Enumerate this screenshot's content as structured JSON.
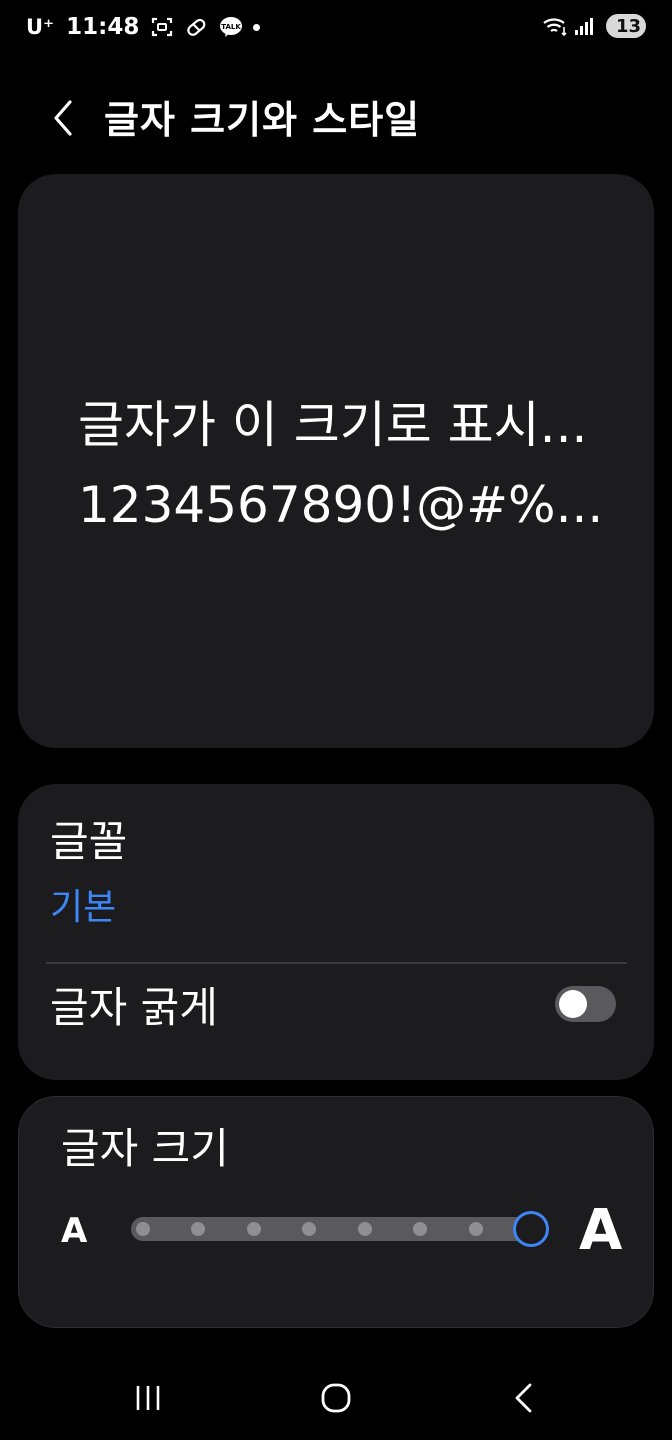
{
  "status_bar": {
    "carrier": "U⁺",
    "time": "11:48",
    "battery_level": "13",
    "icons": [
      "screenshot-icon",
      "pill-icon",
      "kakaotalk-icon",
      "notification-dot",
      "wifi-icon",
      "signal-icon",
      "battery-icon"
    ],
    "kakao_label": "TALK"
  },
  "header": {
    "title": "글자 크기와 스타일"
  },
  "preview": {
    "line1": "글자가 이 크기로 표시...",
    "line2": "1234567890!@#%..."
  },
  "settings": {
    "font_label": "글꼴",
    "font_value": "기본",
    "bold_label": "글자 굵게",
    "bold_enabled": false
  },
  "font_size": {
    "title": "글자 크기",
    "small_label": "A",
    "large_label": "A",
    "steps": 8,
    "current_step": 8
  },
  "colors": {
    "accent": "#3e86f7",
    "card_bg": "#1c1c1e",
    "background": "#000000"
  },
  "nav": {
    "icons": [
      "recent-apps-icon",
      "home-icon",
      "back-icon"
    ]
  }
}
